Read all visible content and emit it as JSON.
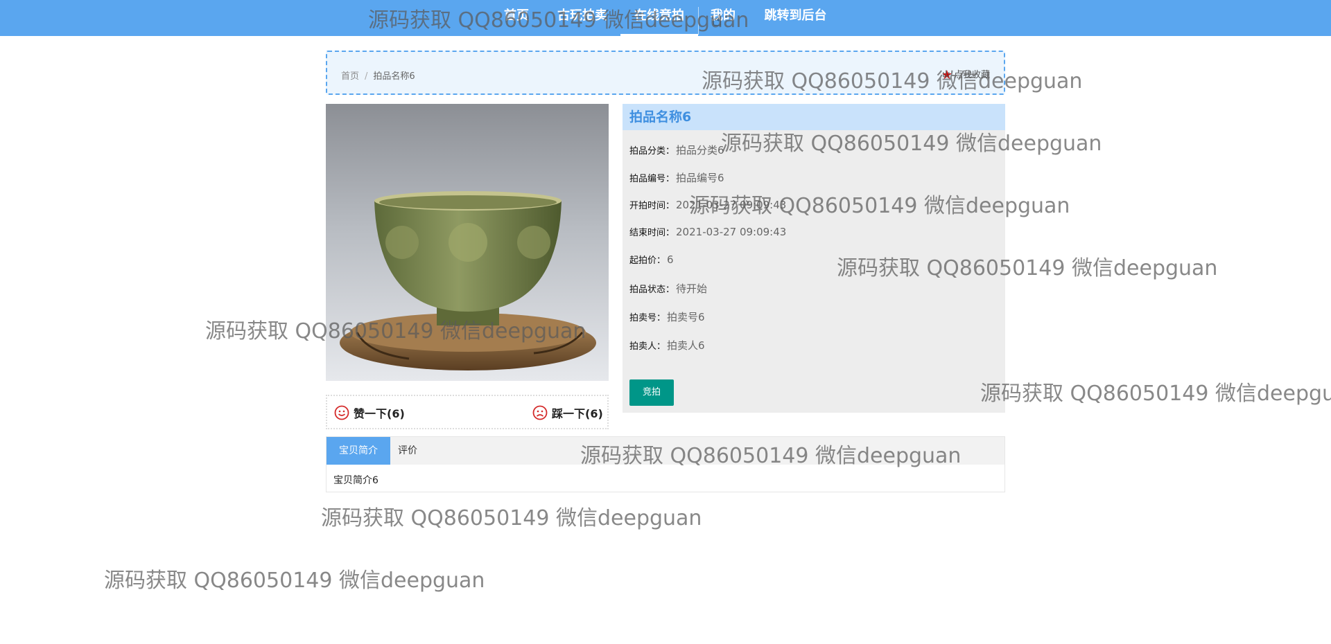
{
  "nav": {
    "items": [
      {
        "label": "首页",
        "active": false
      },
      {
        "label": "古玩拍卖",
        "active": false
      },
      {
        "label": "在线竞拍",
        "active": true
      },
      {
        "label": "我的",
        "active": false
      },
      {
        "label": "跳转到后台",
        "active": false
      }
    ]
  },
  "breadcrumb": {
    "home": "首页",
    "separator": "/",
    "current": "拍品名称6"
  },
  "favorite_label": "点我收藏",
  "product": {
    "title": "拍品名称6",
    "fields": [
      {
        "label": "拍品分类：",
        "value": "拍品分类6"
      },
      {
        "label": "拍品编号：",
        "value": "拍品编号6"
      },
      {
        "label": "开拍时间：",
        "value": "2021-03-27 09:09:43"
      },
      {
        "label": "结束时间：",
        "value": "2021-03-27 09:09:43"
      },
      {
        "label": "起拍价：",
        "value": "6"
      },
      {
        "label": "拍品状态：",
        "value": "待开始"
      },
      {
        "label": "拍卖号：",
        "value": "拍卖号6"
      },
      {
        "label": "拍卖人：",
        "value": "拍卖人6"
      }
    ],
    "bid_button": "竞拍"
  },
  "votes": {
    "like": "赞一下(6)",
    "dislike": "踩一下(6)"
  },
  "tabs": {
    "items": [
      {
        "label": "宝贝简介",
        "active": true
      },
      {
        "label": "评价",
        "active": false
      }
    ],
    "content": "宝贝简介6"
  },
  "watermark_text": "源码获取 QQ86050149 微信deepguan",
  "colors": {
    "nav_bg": "#5aa6ef",
    "title_bar": "#c9e2fb",
    "bid_button": "#009688",
    "star": "#d40000"
  }
}
